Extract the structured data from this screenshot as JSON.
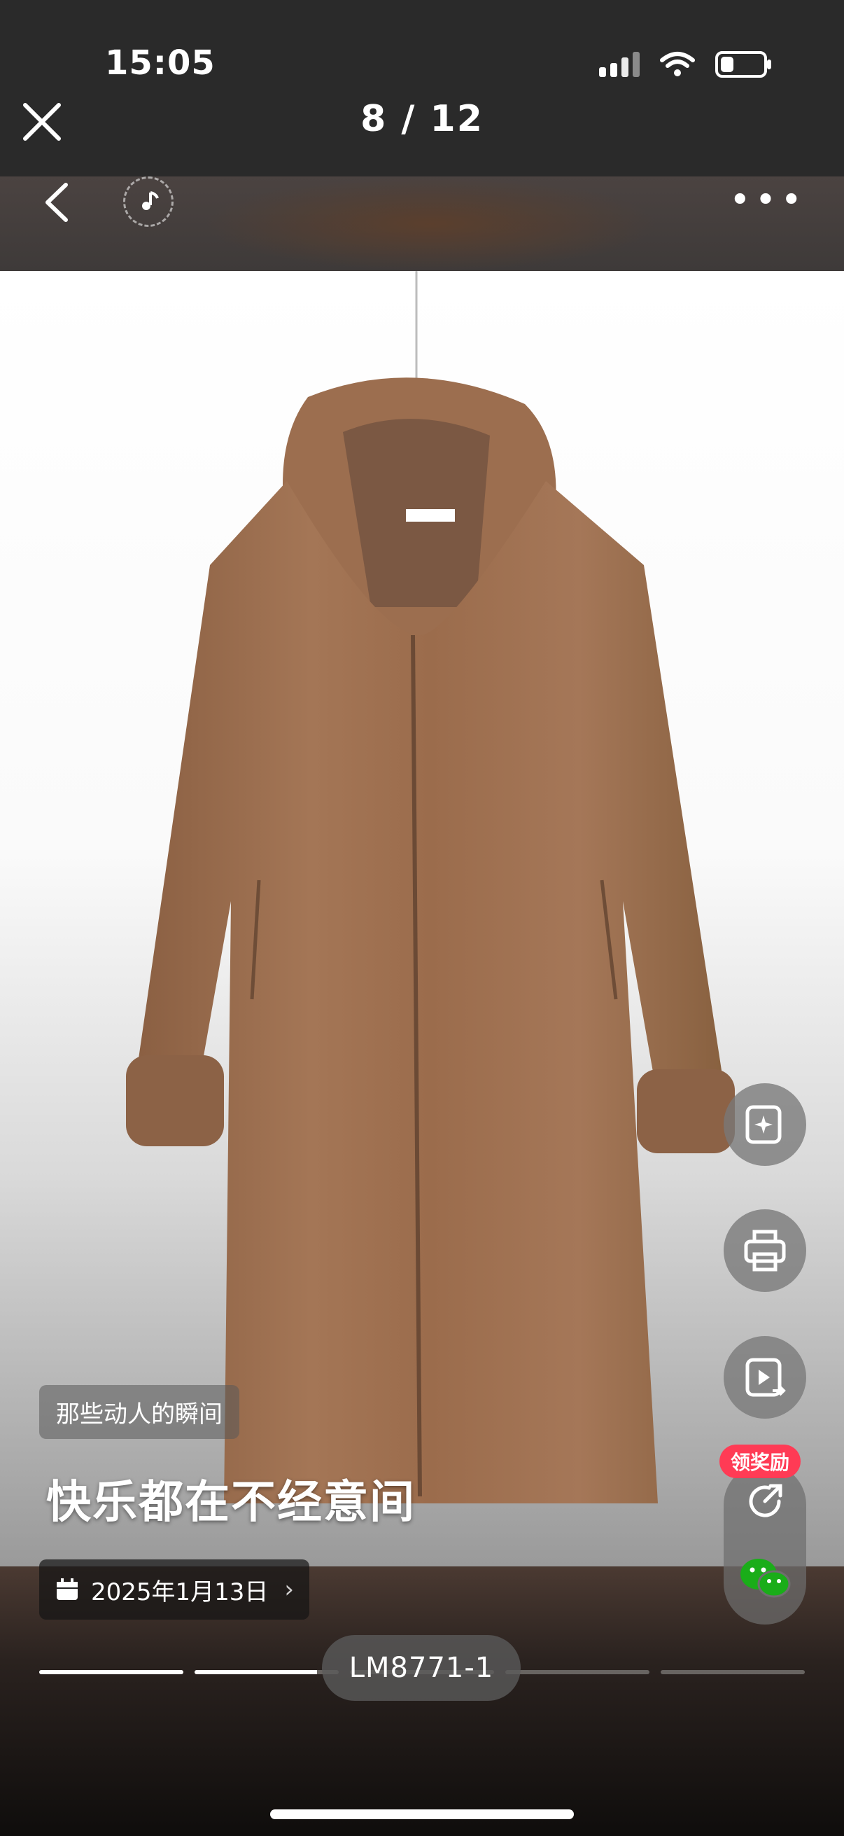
{
  "status_bar": {
    "time": "15:05",
    "battery_level": 0.3
  },
  "viewer": {
    "counter": "8 / 12"
  },
  "icons": {
    "close": "close-icon",
    "back": "back-arrow-icon",
    "music": "music-note-icon",
    "more": "more-dots-icon",
    "magic": "sparkle-card-icon",
    "print": "printer-icon",
    "video": "video-share-icon",
    "share": "share-arrow-icon",
    "wechat": "wechat-icon",
    "calendar": "calendar-icon"
  },
  "post": {
    "tag": "那些动人的瞬间",
    "headline": "快乐都在不经意间",
    "date": "2025年1月13日",
    "sku": "LM8771-1"
  },
  "actions": {
    "reward_badge": "领奖励"
  },
  "progress": {
    "segments": [
      1,
      0.85,
      0,
      0,
      0
    ]
  },
  "colors": {
    "coat": "#9a6e4e",
    "reward": "#ff3b55",
    "wechat": "#1aad19"
  }
}
